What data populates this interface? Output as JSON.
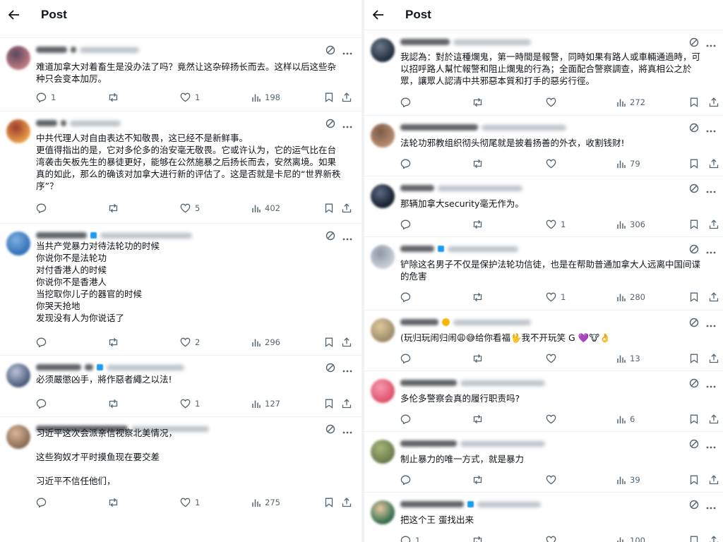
{
  "left": {
    "header": {
      "title": "Post"
    },
    "tweets": [
      {
        "text": "难道加拿大对着畜生是没办法了吗？竟然让这杂碎扬长而去。这样以后这些杂\n种只会变本加厉。",
        "replies": "1",
        "likes": "1",
        "views": "198"
      },
      {
        "text": "中共代理人对自由表达不知敬畏，这已经不是新鲜事。\n更值得指出的是，它对多伦多的治安毫无敬畏。它或许认为，它的运气比在台\n湾袭击矢板先生的暴徒更好，能够在公然施暴之后扬长而去，安然离境。如果\n真的如此，那么的确该对加拿大进行新的评估了。这是否就是卡尼的“世界新秩\n序”？",
        "replies": "",
        "likes": "5",
        "views": "402"
      },
      {
        "text": "当共产党暴力对待法轮功的时候\n你说你不是法轮功\n对付香港人的时候\n你说你不是香港人\n当挖取你儿子的器官的时候\n你哭天抢地\n发现没有人为你说话了",
        "replies": "",
        "likes": "2",
        "views": "296"
      },
      {
        "text": "必须嚴懲凶手，將作惡者繩之以法!",
        "replies": "",
        "likes": "1",
        "views": "127"
      },
      {
        "text": "习近平这次会派亲信视察北美情况，\n\n这些狗奴才平时摸鱼现在要交差\n\n习近平不信任他们，",
        "replies": "",
        "likes": "1",
        "views": "275"
      }
    ]
  },
  "right": {
    "header": {
      "title": "Post"
    },
    "tweets": [
      {
        "text": "我認為：對於這種爛鬼，第一時間是報警，同時如果有路人或車輛通過時，可\n以招呼路人幫忙報警和阻止爛鬼的行為；全面配合警察調查，將真相公之於\n眾，讓眾人認清中共邪惡本質和打手的惡劣行徑。",
        "replies": "",
        "likes": "",
        "views": "272"
      },
      {
        "text": "法轮功邪教组织彻头彻尾就是披着扬善的外衣，收割钱财!",
        "replies": "",
        "likes": "",
        "views": "79"
      },
      {
        "text": "那辆加拿大security毫无作为。",
        "replies": "",
        "likes": "1",
        "views": "306"
      },
      {
        "text": "铲除这名男子不仅是保护法轮功信徒，也是在帮助普通加拿大人远离中国间谍\n的危害",
        "replies": "",
        "likes": "1",
        "views": "280"
      },
      {
        "text": "(玩归玩闹归闹😩😅给你看福🖖我不开玩笑 G 💜🐮👌",
        "replies": "",
        "likes": "",
        "views": "13"
      },
      {
        "text": "多伦多警察会真的履行职责吗?",
        "replies": "",
        "likes": "",
        "views": "6"
      },
      {
        "text": "制止暴力的唯一方式，就是暴力",
        "replies": "",
        "likes": "",
        "views": "39"
      },
      {
        "text": "把这个王   蛋找出来",
        "replies": "1",
        "likes": "",
        "views": "100"
      }
    ]
  },
  "colors": {
    "text": "#0f1419",
    "muted": "#536471",
    "border": "#eff3f4",
    "verified": "#1d9bf0"
  },
  "icons": [
    "back-arrow-icon",
    "grok-icon",
    "more-icon",
    "reply-icon",
    "repost-icon",
    "like-icon",
    "views-icon",
    "bookmark-icon",
    "share-icon"
  ]
}
